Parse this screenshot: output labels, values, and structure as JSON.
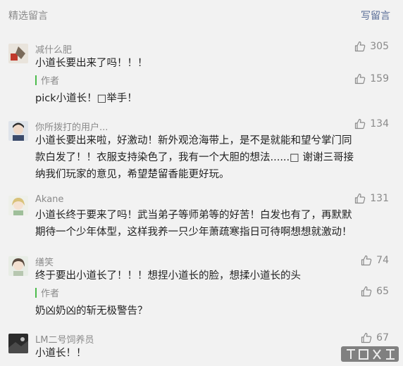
{
  "header": {
    "title": "精选留言",
    "write_label": "写留言"
  },
  "comments": [
    {
      "nick": "减什么肥",
      "content": "小道长要出来了吗！！！",
      "likes": "305",
      "reply": {
        "label": "作者",
        "content": "pick小道长！□举手！",
        "likes": "159"
      }
    },
    {
      "nick": "你所拨打的用户...",
      "content": "小道长要出来啦，好激动！新外观沧海带上，是不是就能和望兮掌门同款白发了！！衣服支持染色了，我有一个大胆的想法......□ 谢谢三哥接纳我们玩家的意见，希望楚留香能更好玩。",
      "likes": "134"
    },
    {
      "nick": "Akane",
      "content": "小道长终于要来了吗！武当弟子等师弟等的好苦！白发也有了，再默默期待一个少年体型，这样我养一只少年萧疏寒指日可待啊想想就激动！",
      "likes": "131"
    },
    {
      "nick": "缮笑",
      "content": "终于要出小道长了！！！想捏小道长的脸，想揉小道长的头",
      "likes": "74",
      "reply": {
        "label": "作者",
        "content": "奶凶奶凶的斩无极警告？",
        "likes": "65"
      }
    },
    {
      "nick": "LM二号饲养员",
      "content": "小道长！！",
      "likes": "67"
    }
  ],
  "icons": {
    "like": "thumbs-up-icon",
    "avatar": "avatar-image"
  },
  "colors": {
    "link": "#576b95",
    "reply_bar": "#4cbc4c",
    "muted": "#8a8a8a"
  }
}
